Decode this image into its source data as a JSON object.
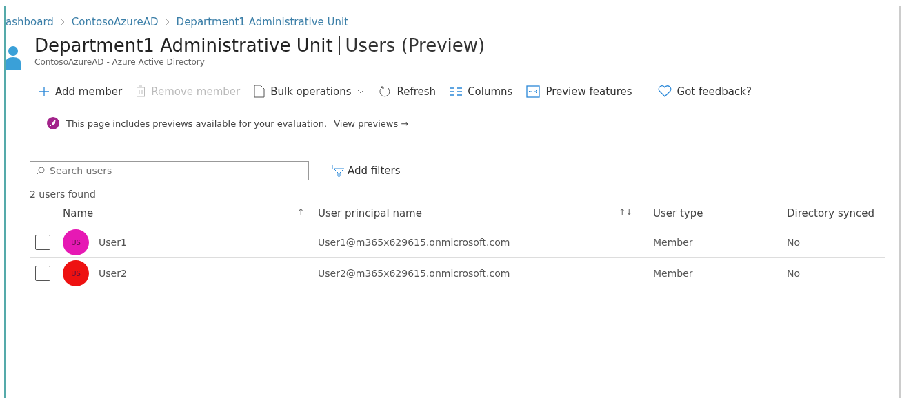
{
  "breadcrumb": [
    "ashboard",
    "ContosoAzureAD",
    "Department1 Administrative Unit"
  ],
  "header": {
    "title": "Department1 Administrative Unit",
    "section": "Users (Preview)",
    "subtitle": "ContosoAzureAD - Azure Active Directory"
  },
  "toolbar": [
    {
      "kind": "plus",
      "label": "Add member",
      "disabled": false
    },
    {
      "kind": "trash",
      "label": "Remove member",
      "disabled": true
    },
    {
      "kind": "file",
      "label": "Bulk operations",
      "disabled": false
    },
    {
      "kind": "refresh",
      "label": "Refresh",
      "disabled": false
    },
    {
      "kind": "columns",
      "label": "Columns",
      "disabled": false
    },
    {
      "kind": "preview",
      "label": "Preview features",
      "disabled": false
    },
    {
      "kind": "heart",
      "label": "Got feedback?",
      "disabled": false
    }
  ],
  "banner": {
    "text": "This page includes previews available for your evaluation.",
    "link": "View previews →"
  },
  "search": {
    "placeholder": "Search users"
  },
  "add_filters": "Add filters",
  "count": "2 users found",
  "table": {
    "columns": [
      {
        "label": "Name",
        "sort": "↑"
      },
      {
        "label": "User principal name",
        "sort": "↑↓"
      },
      {
        "label": "User type"
      },
      {
        "label": "Directory synced"
      }
    ],
    "rows": [
      {
        "initials": "US",
        "color": "#e619b4",
        "name": "User1",
        "upn": "User1@m365x629615.onmicrosoft.com",
        "type": "Member",
        "synced": "No",
        "checked": false
      },
      {
        "initials": "US",
        "color": "#ee1111",
        "name": "User2",
        "upn": "User2@m365x629615.onmicrosoft.com",
        "type": "Member",
        "synced": "No",
        "checked": false
      }
    ]
  }
}
